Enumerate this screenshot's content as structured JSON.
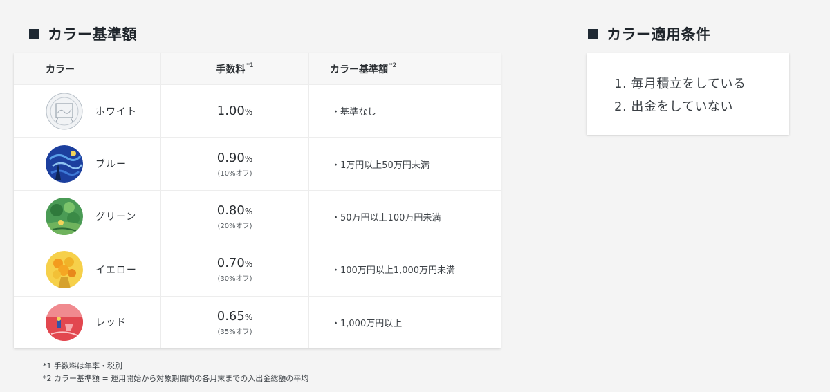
{
  "left_section": {
    "title": "カラー基準額"
  },
  "table": {
    "headers": {
      "color": "カラー",
      "fee": "手数料",
      "fee_note": "*1",
      "base": "カラー基準額",
      "base_note": "*2"
    },
    "rows": [
      {
        "name": "ホワイト",
        "rate": "1.00",
        "unit": "%",
        "discount": "",
        "base": "・基準なし",
        "icon": "white-painting-icon",
        "color": "#dfe3e8"
      },
      {
        "name": "ブルー",
        "rate": "0.90",
        "unit": "%",
        "discount": "(10%オフ)",
        "base": "・1万円以上50万円未満",
        "icon": "blue-painting-icon",
        "color": "#1f4fbf"
      },
      {
        "name": "グリーン",
        "rate": "0.80",
        "unit": "%",
        "discount": "(20%オフ)",
        "base": "・50万円以上100万円未満",
        "icon": "green-painting-icon",
        "color": "#3f9a4e"
      },
      {
        "name": "イエロー",
        "rate": "0.70",
        "unit": "%",
        "discount": "(30%オフ)",
        "base": "・100万円以上1,000万円未満",
        "icon": "yellow-painting-icon",
        "color": "#f5c22e"
      },
      {
        "name": "レッド",
        "rate": "0.65",
        "unit": "%",
        "discount": "(35%オフ)",
        "base": "・1,000万円以上",
        "icon": "red-painting-icon",
        "color": "#e4505a"
      }
    ]
  },
  "footnotes": {
    "note1": "*1 手数料は年率・税別",
    "note2": "*2 カラー基準額 = 運用開始から対象期間内の各月末までの入出金総額の平均"
  },
  "right_section": {
    "title": "カラー適用条件",
    "conditions": [
      "1. 毎月積立をしている",
      "2. 出金をしていない"
    ]
  }
}
